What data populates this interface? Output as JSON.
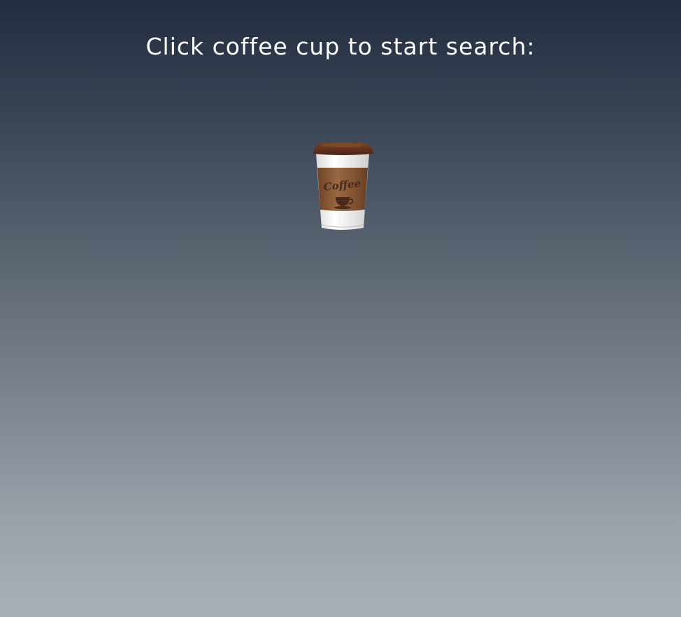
{
  "prompt": {
    "text": "Click coffee cup to start search:"
  },
  "coffee_cup": {
    "icon": "coffee-cup-icon",
    "brand_text": "Coffee",
    "colors": {
      "lid": "#5a2e1d",
      "sleeve": "#8c5a36",
      "cup": "#f2f2f2"
    }
  }
}
